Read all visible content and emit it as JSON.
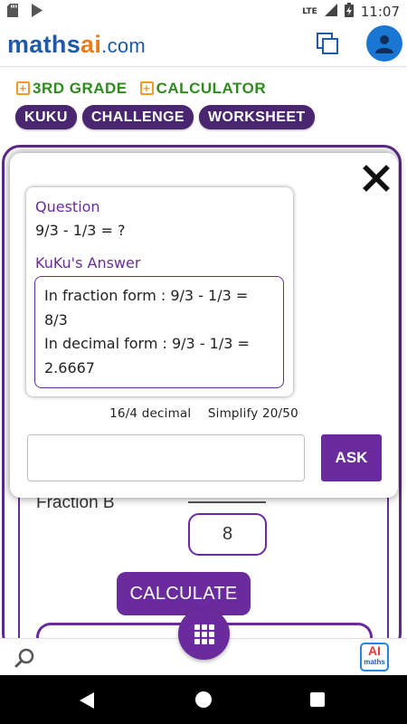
{
  "status_bar": {
    "time": "11:07",
    "network": "LTE",
    "icons": [
      "sd-card-icon",
      "play-store-icon",
      "signal-icon",
      "battery-charging-icon"
    ]
  },
  "header": {
    "logo_parts": [
      "math",
      "s",
      "ai",
      ".com"
    ],
    "icons": [
      "copy-icon",
      "user-icon"
    ]
  },
  "nav_links": {
    "grade": "3RD GRADE",
    "calculator": "CALCULATOR"
  },
  "pills": [
    "KUKU",
    "CHALLENGE",
    "WORKSHEET"
  ],
  "background_form": {
    "fraction_b_label": "Fraction B",
    "fraction_b_value": "8",
    "calculate_label": "CALCULATE"
  },
  "modal": {
    "question_label": "Question",
    "question_text": "9/3 - 1/3 = ?",
    "answer_label": "KuKu's Answer",
    "answer_lines": [
      "In fraction form : 9/3 - 1/3 =",
      "8/3",
      "In decimal form : 9/3 - 1/3 =",
      "2.6667"
    ],
    "suggestions": [
      "16/4 decimal",
      "Simplify 20/50"
    ],
    "input_value": "",
    "input_placeholder": "",
    "ask_label": "ASK"
  },
  "bottom_bar": {
    "ai_logo_top": "AI",
    "ai_logo_bottom": "maths"
  },
  "colors": {
    "purple": "#6a2b9c",
    "dark_purple": "#4a2670",
    "green": "#2e8b1e",
    "orange": "#ec7a1c",
    "blue": "#1e5aa8"
  }
}
